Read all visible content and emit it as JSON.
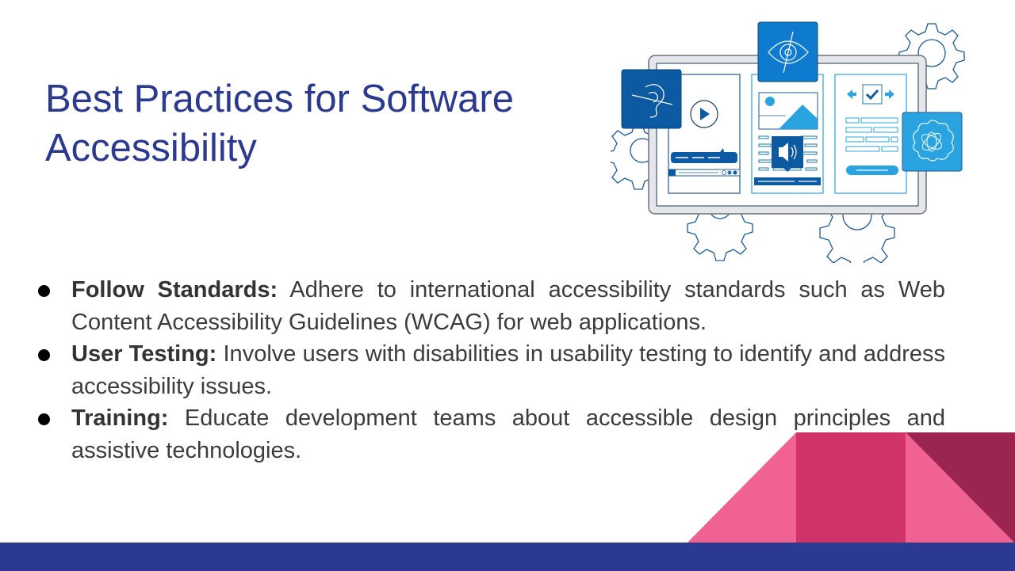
{
  "slide": {
    "title": "Best Practices for Software Accessibility",
    "bullets": [
      {
        "term": "Follow Standards:",
        "text": " Adhere to international accessibility standards such as Web Content Accessibility Guidelines (WCAG) for web applications."
      },
      {
        "term": "User Testing:",
        "text": " Involve users with disabilities in usability testing to identify and address accessibility issues."
      },
      {
        "term": "Training:",
        "text": " Educate development teams about accessible design principles and assistive technologies."
      }
    ]
  },
  "illustration": {
    "icons": [
      "hearing-impaired-icon",
      "vision-impaired-icon",
      "cognitive-brain-icon",
      "play-icon",
      "speaker-icon",
      "checkbox-icon",
      "gear-icon"
    ]
  },
  "colors": {
    "title": "#2b3990",
    "footer_bar": "#2b3990",
    "pink_light": "#f06292",
    "pink_mid": "#d13368",
    "maroon": "#9c2450",
    "blue_dark": "#0b5aa2",
    "blue_mid": "#0f7bcf",
    "blue_light": "#2aa4e0"
  }
}
